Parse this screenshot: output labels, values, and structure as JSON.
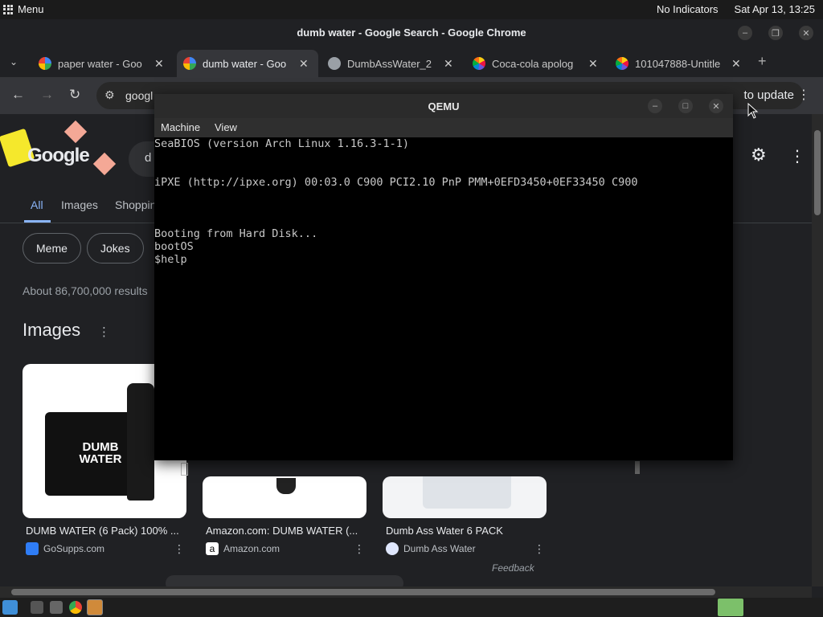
{
  "system": {
    "menu_label": "Menu",
    "indicators": "No Indicators",
    "clock": "Sat Apr 13, 13:25"
  },
  "chrome": {
    "window_title": "dumb water - Google Search - Google Chrome",
    "tabs": [
      {
        "label": "paper water - Goo",
        "favicon": "google-icon"
      },
      {
        "label": "dumb water - Goo",
        "favicon": "google-icon"
      },
      {
        "label": "DumbAssWater_2",
        "favicon": "globe-icon"
      },
      {
        "label": "Coca-cola apolog",
        "favicon": "nbc-icon"
      },
      {
        "label": "101047888-Untitle",
        "favicon": "nbc-icon"
      }
    ],
    "new_tab": "+",
    "url": "googl",
    "update_label": "to update"
  },
  "google": {
    "nav_tabs": [
      "All",
      "Images",
      "Shoppin"
    ],
    "chips": [
      "Meme",
      "Jokes"
    ],
    "result_stats": "About 86,700,000 results",
    "images_heading": "Images",
    "cards": [
      {
        "title": "DUMB WATER (6 Pack) 100% ...",
        "source": "GoSupps.com",
        "product_text": "DUMB WATER",
        "bottle_text": "DUMB WATER"
      },
      {
        "title": "Amazon.com: DUMB WATER (...",
        "source": "Amazon.com"
      },
      {
        "title": "Dumb Ass Water 6 PACK",
        "source": "Dumb Ass Water"
      }
    ],
    "feedback": "Feedback",
    "search_prefix": "d"
  },
  "qemu": {
    "title": "QEMU",
    "menu": [
      "Machine",
      "View"
    ],
    "lines": [
      "SeaBIOS (version Arch Linux 1.16.3-1-1)",
      "iPXE (http://ipxe.org) 00:03.0 C900 PCI2.10 PnP PMM+0EFD3450+0EF33450 C900",
      "Booting from Hard Disk...",
      "bootOS",
      "$help"
    ]
  },
  "colors": {
    "accent_blue": "#8ab4f8",
    "page_bg": "#202124",
    "terminal_bg": "#000000"
  }
}
